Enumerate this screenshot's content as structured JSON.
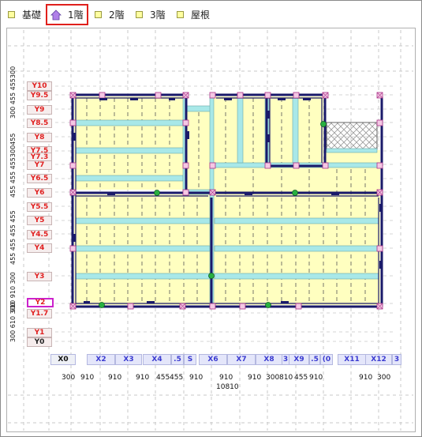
{
  "tabs": [
    {
      "label": "基礎",
      "active": false
    },
    {
      "label": "1階",
      "active": true
    },
    {
      "label": "2階",
      "active": false
    },
    {
      "label": "3階",
      "active": false
    },
    {
      "label": "屋根",
      "active": false
    }
  ],
  "y_axis_labels": [
    "Y10",
    "Y9.5",
    "Y9",
    "Y8.5",
    "Y8",
    "Y7.5",
    "Y7.3",
    "Y7",
    "Y6.5",
    "Y6",
    "Y5.5",
    "Y5",
    "Y4.5",
    "Y4",
    "Y3",
    "Y2",
    "Y1.7",
    "Y1",
    "Y0"
  ],
  "y_selected": "Y2",
  "x_axis_labels": [
    "X0",
    "X2",
    "X3",
    "X4",
    ".5",
    "S",
    "X6",
    "X7",
    "X8",
    "3",
    "X9",
    ".5",
    "(0",
    "X11",
    "X12",
    "3"
  ],
  "x_dimensions": [
    "300",
    "910",
    "910",
    "910",
    "455",
    "455",
    "910",
    "910",
    "910",
    "300",
    "810",
    "455",
    "910",
    "910",
    "300"
  ],
  "x_total": "10810",
  "y_dimensions": [
    "300",
    "455",
    "455",
    "455",
    "455",
    "455",
    "455",
    "455",
    "455",
    "455",
    "455",
    "455",
    "455",
    "910",
    "910",
    "300",
    "300",
    "610",
    "300"
  ],
  "colors": {
    "wall": "#1a1a6a",
    "beam": "#a8e8e8",
    "floor": "#ffffc0",
    "post": "#ee88cc",
    "accent": "#e0201c"
  },
  "icons": {
    "tab_marker": "yellow-square-icon",
    "active_floor": "house-icon"
  }
}
